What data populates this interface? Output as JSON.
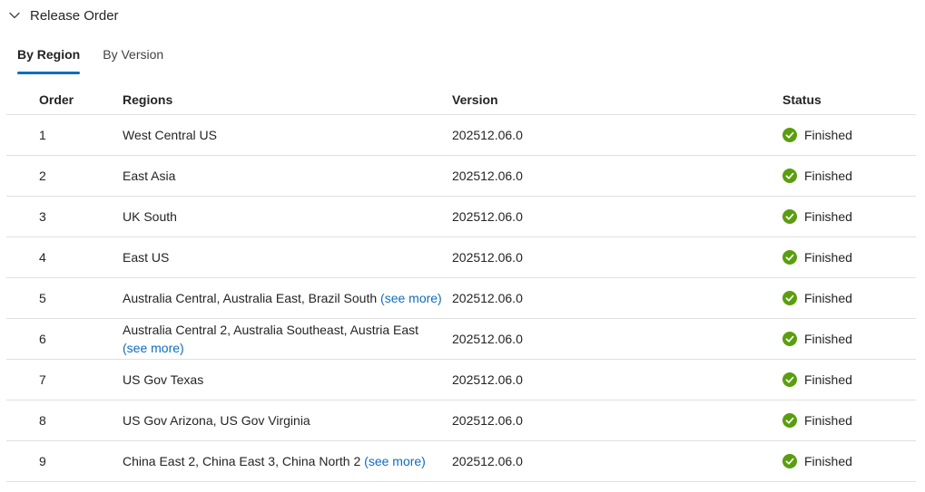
{
  "section": {
    "title": "Release Order"
  },
  "tabs": [
    {
      "label": "By Region",
      "active": true
    },
    {
      "label": "By Version",
      "active": false
    }
  ],
  "table": {
    "headers": {
      "order": "Order",
      "regions": "Regions",
      "version": "Version",
      "status": "Status"
    },
    "rows": [
      {
        "order": "1",
        "regions": "West Central US",
        "see_more": "",
        "version": "202512.06.0",
        "status": "Finished"
      },
      {
        "order": "2",
        "regions": "East Asia",
        "see_more": "",
        "version": "202512.06.0",
        "status": "Finished"
      },
      {
        "order": "3",
        "regions": "UK South",
        "see_more": "",
        "version": "202512.06.0",
        "status": "Finished"
      },
      {
        "order": "4",
        "regions": "East US",
        "see_more": "",
        "version": "202512.06.0",
        "status": "Finished"
      },
      {
        "order": "5",
        "regions": "Australia Central, Australia East, Brazil South",
        "see_more": "(see more)",
        "version": "202512.06.0",
        "status": "Finished"
      },
      {
        "order": "6",
        "regions": "Australia Central 2, Australia Southeast, Austria East",
        "see_more": "(see more)",
        "version": "202512.06.0",
        "status": "Finished"
      },
      {
        "order": "7",
        "regions": "US Gov Texas",
        "see_more": "",
        "version": "202512.06.0",
        "status": "Finished"
      },
      {
        "order": "8",
        "regions": "US Gov Arizona, US Gov Virginia",
        "see_more": "",
        "version": "202512.06.0",
        "status": "Finished"
      },
      {
        "order": "9",
        "regions": "China East 2, China East 3, China North 2",
        "see_more": "(see more)",
        "version": "202512.06.0",
        "status": "Finished"
      }
    ]
  },
  "icons": {
    "collapse": "chevron-down-icon",
    "status": "checkmark-circle-icon"
  },
  "colors": {
    "accent": "#0f6cbd",
    "success": "#5a9e0f",
    "divider": "#e0e0e0"
  }
}
